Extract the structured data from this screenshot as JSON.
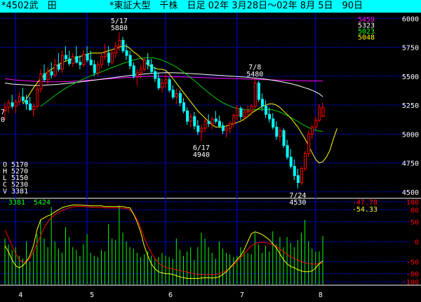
{
  "header": {
    "symbol": "*4502武　田",
    "market": "*東証大型　千株　日足 02年 3月28日〜02年 8月 5日　90日"
  },
  "colors": {
    "header_bg": "#00ffff",
    "grid": "#0000ff",
    "up": "#ff0000",
    "down": "#00ffff",
    "ma_short": "#ffff00",
    "ma_mid": "#00cc00",
    "ma_long": "#ffffff",
    "ma_xlong": "#ff00ff",
    "volume": "#00ff00",
    "osc_fast": "#ffff00",
    "osc_slow": "#ff0000",
    "tick_text": "#ffffff"
  },
  "price_axis": {
    "ticks": [
      "6000",
      "5750",
      "5500",
      "5250",
      "5000",
      "4750",
      "4500"
    ]
  },
  "ma_legend": [
    {
      "value": "5459",
      "color": "#ff00ff"
    },
    {
      "value": "5323",
      "color": "#ffffff"
    },
    {
      "value": "5023",
      "color": "#00ff00"
    },
    {
      "value": "5048",
      "color": "#ffff00"
    }
  ],
  "ohlc_box": {
    "open": "O 5170",
    "high": "H 5270",
    "low": "L 5150",
    "close": "C 5230",
    "volume": "V 3381"
  },
  "left_partial": {
    "line1": "7",
    "line2": "0"
  },
  "annotations": [
    {
      "date": "5/17",
      "price": "5880",
      "candle": 32
    },
    {
      "date": "7/8",
      "price": "5480",
      "candle": 70
    },
    {
      "date": "6/17",
      "price": "4940",
      "candle": 55
    },
    {
      "date": "7/24",
      "price": "4530",
      "candle": 82
    }
  ],
  "volume_labels": {
    "last_volume": "3381",
    "volume_ma": "5424"
  },
  "osc_labels": {
    "fast": "-47.78",
    "slow": "-54.33"
  },
  "osc_axis": {
    "ticks": [
      "100",
      "80",
      "50",
      "0",
      "-50",
      "-80",
      "-100"
    ]
  },
  "x_axis": {
    "labels": [
      "4",
      "5",
      "6",
      "7",
      "8"
    ]
  },
  "chart_data": {
    "type": "candlestick",
    "period": "02年 3月28日〜02年 8月 5日",
    "ylim": [
      4450,
      6050
    ],
    "x_month_boundaries": [
      {
        "label": "4",
        "candle": 3
      },
      {
        "label": "5",
        "candle": 23
      },
      {
        "label": "6",
        "candle": 45
      },
      {
        "label": "7",
        "candle": 65
      },
      {
        "label": "8",
        "candle": 87
      }
    ],
    "candles": [
      [
        5200,
        5270,
        5120,
        5230
      ],
      [
        5230,
        5300,
        5180,
        5270
      ],
      [
        5270,
        5340,
        5220,
        5240
      ],
      [
        5240,
        5300,
        5180,
        5280
      ],
      [
        5280,
        5360,
        5250,
        5320
      ],
      [
        5320,
        5400,
        5270,
        5290
      ],
      [
        5290,
        5340,
        5210,
        5260
      ],
      [
        5260,
        5320,
        5200,
        5210
      ],
      [
        5210,
        5270,
        5150,
        5240
      ],
      [
        5240,
        5420,
        5220,
        5390
      ],
      [
        5390,
        5560,
        5360,
        5520
      ],
      [
        5520,
        5600,
        5450,
        5470
      ],
      [
        5470,
        5580,
        5430,
        5540
      ],
      [
        5540,
        5620,
        5480,
        5510
      ],
      [
        5510,
        5650,
        5490,
        5600
      ],
      [
        5600,
        5700,
        5540,
        5560
      ],
      [
        5560,
        5720,
        5530,
        5680
      ],
      [
        5680,
        5760,
        5630,
        5650
      ],
      [
        5650,
        5720,
        5590,
        5610
      ],
      [
        5610,
        5700,
        5580,
        5670
      ],
      [
        5670,
        5760,
        5610,
        5620
      ],
      [
        5620,
        5680,
        5560,
        5600
      ],
      [
        5600,
        5730,
        5580,
        5690
      ],
      [
        5690,
        5760,
        5620,
        5640
      ],
      [
        5640,
        5720,
        5590,
        5600
      ],
      [
        5600,
        5640,
        5500,
        5530
      ],
      [
        5530,
        5630,
        5500,
        5600
      ],
      [
        5600,
        5700,
        5570,
        5670
      ],
      [
        5670,
        5780,
        5640,
        5700
      ],
      [
        5700,
        5760,
        5590,
        5620
      ],
      [
        5620,
        5730,
        5600,
        5700
      ],
      [
        5700,
        5800,
        5660,
        5760
      ],
      [
        5760,
        5880,
        5720,
        5810
      ],
      [
        5810,
        5840,
        5700,
        5720
      ],
      [
        5720,
        5780,
        5640,
        5680
      ],
      [
        5680,
        5720,
        5560,
        5590
      ],
      [
        5590,
        5620,
        5480,
        5500
      ],
      [
        5500,
        5560,
        5420,
        5530
      ],
      [
        5530,
        5600,
        5480,
        5560
      ],
      [
        5560,
        5660,
        5540,
        5640
      ],
      [
        5640,
        5700,
        5560,
        5600
      ],
      [
        5600,
        5650,
        5520,
        5540
      ],
      [
        5540,
        5580,
        5450,
        5480
      ],
      [
        5480,
        5530,
        5380,
        5400
      ],
      [
        5400,
        5480,
        5360,
        5440
      ],
      [
        5440,
        5520,
        5400,
        5470
      ],
      [
        5470,
        5490,
        5360,
        5380
      ],
      [
        5380,
        5420,
        5300,
        5320
      ],
      [
        5320,
        5390,
        5260,
        5350
      ],
      [
        5350,
        5380,
        5240,
        5270
      ],
      [
        5270,
        5310,
        5180,
        5200
      ],
      [
        5200,
        5230,
        5080,
        5110
      ],
      [
        5110,
        5180,
        5060,
        5150
      ],
      [
        5150,
        5190,
        5040,
        5070
      ],
      [
        5070,
        5120,
        4990,
        5020
      ],
      [
        5020,
        5080,
        4940,
        5050
      ],
      [
        5050,
        5140,
        5020,
        5110
      ],
      [
        5110,
        5170,
        5060,
        5090
      ],
      [
        5090,
        5150,
        5040,
        5130
      ],
      [
        5130,
        5200,
        5090,
        5110
      ],
      [
        5110,
        5160,
        5050,
        5070
      ],
      [
        5070,
        5100,
        5000,
        5030
      ],
      [
        5030,
        5080,
        4970,
        5050
      ],
      [
        5050,
        5110,
        5010,
        5090
      ],
      [
        5090,
        5180,
        5060,
        5160
      ],
      [
        5160,
        5250,
        5120,
        5220
      ],
      [
        5220,
        5240,
        5120,
        5150
      ],
      [
        5150,
        5220,
        5110,
        5190
      ],
      [
        5190,
        5250,
        5150,
        5200
      ],
      [
        5200,
        5260,
        5160,
        5240
      ],
      [
        5240,
        5480,
        5220,
        5440
      ],
      [
        5440,
        5460,
        5280,
        5300
      ],
      [
        5300,
        5350,
        5200,
        5240
      ],
      [
        5240,
        5290,
        5140,
        5170
      ],
      [
        5170,
        5230,
        5100,
        5130
      ],
      [
        5130,
        5180,
        5040,
        5060
      ],
      [
        5060,
        5110,
        4950,
        4980
      ],
      [
        4980,
        5060,
        4930,
        5030
      ],
      [
        5030,
        5050,
        4880,
        4900
      ],
      [
        4900,
        4950,
        4780,
        4800
      ],
      [
        4800,
        4870,
        4700,
        4720
      ],
      [
        4720,
        4780,
        4600,
        4640
      ],
      [
        4640,
        4700,
        4530,
        4580
      ],
      [
        4580,
        4720,
        4560,
        4700
      ],
      [
        4700,
        4850,
        4680,
        4830
      ],
      [
        4830,
        5030,
        4800,
        5000
      ],
      [
        5000,
        5080,
        4960,
        5060
      ],
      [
        5060,
        5150,
        5040,
        5120
      ],
      [
        5120,
        5260,
        5100,
        5230
      ],
      [
        5150,
        5270,
        5150,
        5230
      ]
    ],
    "moving_averages": [
      {
        "name": "5459",
        "color": "#ff00ff",
        "start": 0,
        "values": [
          5480,
          5475,
          5470,
          5467,
          5465,
          5462,
          5460,
          5458,
          5456,
          5455,
          5454,
          5453,
          5452,
          5452,
          5452,
          5452,
          5453,
          5454,
          5455,
          5456,
          5458,
          5460,
          5462,
          5464,
          5466,
          5468,
          5470,
          5472,
          5475,
          5478,
          5480,
          5482,
          5484,
          5486,
          5488,
          5490,
          5492,
          5494,
          5496,
          5498,
          5500,
          5500,
          5500,
          5500,
          5499,
          5498,
          5497,
          5496,
          5495,
          5494,
          5493,
          5492,
          5491,
          5490,
          5489,
          5488,
          5487,
          5486,
          5485,
          5484,
          5483,
          5482,
          5481,
          5480,
          5479,
          5478,
          5477,
          5476,
          5475,
          5474,
          5473,
          5472,
          5471,
          5470,
          5469,
          5468,
          5467,
          5466,
          5465,
          5464,
          5463,
          5462,
          5461,
          5460,
          5460,
          5459,
          5459,
          5459,
          5459,
          5459
        ]
      },
      {
        "name": "5323",
        "color": "#ffffff",
        "start": 0,
        "values": [
          5440,
          5436,
          5432,
          5430,
          5428,
          5426,
          5424,
          5422,
          5420,
          5420,
          5421,
          5422,
          5424,
          5426,
          5428,
          5430,
          5433,
          5436,
          5439,
          5442,
          5446,
          5450,
          5454,
          5458,
          5462,
          5466,
          5470,
          5474,
          5478,
          5482,
          5486,
          5490,
          5494,
          5498,
          5502,
          5506,
          5510,
          5513,
          5516,
          5519,
          5522,
          5524,
          5526,
          5528,
          5529,
          5530,
          5530,
          5530,
          5529,
          5528,
          5527,
          5525,
          5523,
          5521,
          5519,
          5517,
          5515,
          5513,
          5511,
          5509,
          5507,
          5505,
          5503,
          5501,
          5499,
          5497,
          5495,
          5493,
          5490,
          5487,
          5484,
          5481,
          5478,
          5474,
          5470,
          5465,
          5460,
          5454,
          5448,
          5442,
          5436,
          5428,
          5420,
          5410,
          5400,
          5390,
          5378,
          5364,
          5348,
          5323
        ]
      },
      {
        "name": "5023",
        "color": "#00cc00",
        "start": 10,
        "values": [
          5240,
          5262,
          5286,
          5310,
          5332,
          5354,
          5376,
          5396,
          5414,
          5430,
          5446,
          5462,
          5476,
          5490,
          5502,
          5514,
          5526,
          5538,
          5550,
          5562,
          5574,
          5586,
          5598,
          5610,
          5620,
          5630,
          5640,
          5648,
          5654,
          5658,
          5660,
          5660,
          5656,
          5648,
          5638,
          5626,
          5612,
          5596,
          5578,
          5558,
          5536,
          5512,
          5488,
          5462,
          5436,
          5410,
          5384,
          5358,
          5334,
          5310,
          5290,
          5272,
          5256,
          5242,
          5230,
          5220,
          5214,
          5210,
          5208,
          5208,
          5210,
          5212,
          5214,
          5214,
          5212,
          5208,
          5200,
          5190,
          5176,
          5160,
          5144,
          5126,
          5108,
          5090,
          5072,
          5056,
          5042,
          5032,
          5026,
          5023
        ]
      },
      {
        "name": "5048",
        "color": "#ffff00",
        "start": 5,
        "values": [
          5260,
          5300,
          5350,
          5400,
          5440,
          5480,
          5510,
          5540,
          5560,
          5580,
          5600,
          5620,
          5630,
          5640,
          5650,
          5660,
          5670,
          5680,
          5690,
          5700,
          5700,
          5700,
          5700,
          5710,
          5720,
          5730,
          5740,
          5750,
          5760,
          5760,
          5740,
          5710,
          5690,
          5660,
          5630,
          5600,
          5580,
          5570,
          5560,
          5560,
          5550,
          5520,
          5480,
          5440,
          5400,
          5360,
          5320,
          5280,
          5240,
          5200,
          5170,
          5140,
          5110,
          5080,
          5060,
          5060,
          5060,
          5070,
          5080,
          5090,
          5100,
          5110,
          5130,
          5150,
          5180,
          5200,
          5220,
          5240,
          5250,
          5260,
          5260,
          5250,
          5230,
          5200,
          5170,
          5140,
          5100,
          5060,
          5010,
          4960,
          4900,
          4840,
          4780,
          4750,
          4760,
          4800,
          4860,
          4960,
          5048
        ]
      }
    ],
    "volume": [
      3200,
      2800,
      2400,
      2600,
      2000,
      1800,
      3000,
      1600,
      2400,
      3500,
      4500,
      3200,
      2600,
      5400,
      3000,
      2500,
      2200,
      4000,
      3300,
      2600,
      2400,
      2000,
      2800,
      3500,
      2200,
      2000,
      1900,
      2400,
      2300,
      4200,
      3200,
      3100,
      5500,
      3600,
      3000,
      2600,
      2500,
      2200,
      1900,
      2100,
      2300,
      2000,
      1800,
      1900,
      2200,
      2000,
      1900,
      1800,
      3200,
      2400,
      2000,
      2300,
      2600,
      1700,
      2600,
      3600,
      3200,
      2600,
      2200,
      1800,
      3000,
      2500,
      2200,
      2100,
      1900,
      2000,
      2600,
      2300,
      2200,
      2100,
      3600,
      2800,
      2200,
      2700,
      2300,
      3700,
      2800,
      3300,
      2600,
      3300,
      2900,
      2600,
      3100,
      3600,
      4500,
      3000,
      2500,
      2300,
      2300,
      3381
    ],
    "volume_ymax": 6000,
    "oscillator": {
      "ylim": [
        -100,
        100
      ],
      "fast": [
        -10,
        -25,
        -45,
        -60,
        -65,
        -60,
        -50,
        -35,
        -10,
        30,
        55,
        60,
        65,
        68,
        75,
        80,
        85,
        88,
        90,
        92,
        92,
        92,
        91,
        91,
        90,
        90,
        90,
        90,
        88,
        88,
        88,
        88,
        88,
        88,
        86,
        85,
        70,
        50,
        25,
        -10,
        -35,
        -55,
        -68,
        -75,
        -78,
        -80,
        -80,
        -82,
        -85,
        -88,
        -90,
        -92,
        -92,
        -92,
        -92,
        -91,
        -90,
        -90,
        -91,
        -90,
        -88,
        -82,
        -75,
        -65,
        -55,
        -45,
        -35,
        -20,
        0,
        20,
        25,
        22,
        18,
        12,
        5,
        -5,
        -15,
        -30,
        -45,
        -55,
        -62,
        -65,
        -70,
        -73,
        -75,
        -75,
        -73,
        -66,
        -55,
        -47.78
      ],
      "slow": [
        30,
        10,
        -10,
        -30,
        -45,
        -52,
        -50,
        -42,
        -25,
        -5,
        15,
        35,
        50,
        60,
        68,
        74,
        78,
        82,
        85,
        87,
        88,
        88,
        88,
        87,
        87,
        86,
        86,
        86,
        85,
        85,
        85,
        85,
        85,
        84,
        83,
        80,
        70,
        55,
        35,
        10,
        -10,
        -28,
        -42,
        -52,
        -60,
        -64,
        -66,
        -68,
        -70,
        -72,
        -74,
        -76,
        -78,
        -80,
        -82,
        -82,
        -82,
        -82,
        -82,
        -82,
        -80,
        -76,
        -72,
        -66,
        -58,
        -50,
        -40,
        -30,
        -20,
        -10,
        -5,
        -2,
        -1,
        -2,
        -4,
        -8,
        -12,
        -18,
        -25,
        -32,
        -38,
        -42,
        -46,
        -50,
        -53,
        -55,
        -56,
        -56,
        -55,
        -54.33
      ]
    }
  }
}
